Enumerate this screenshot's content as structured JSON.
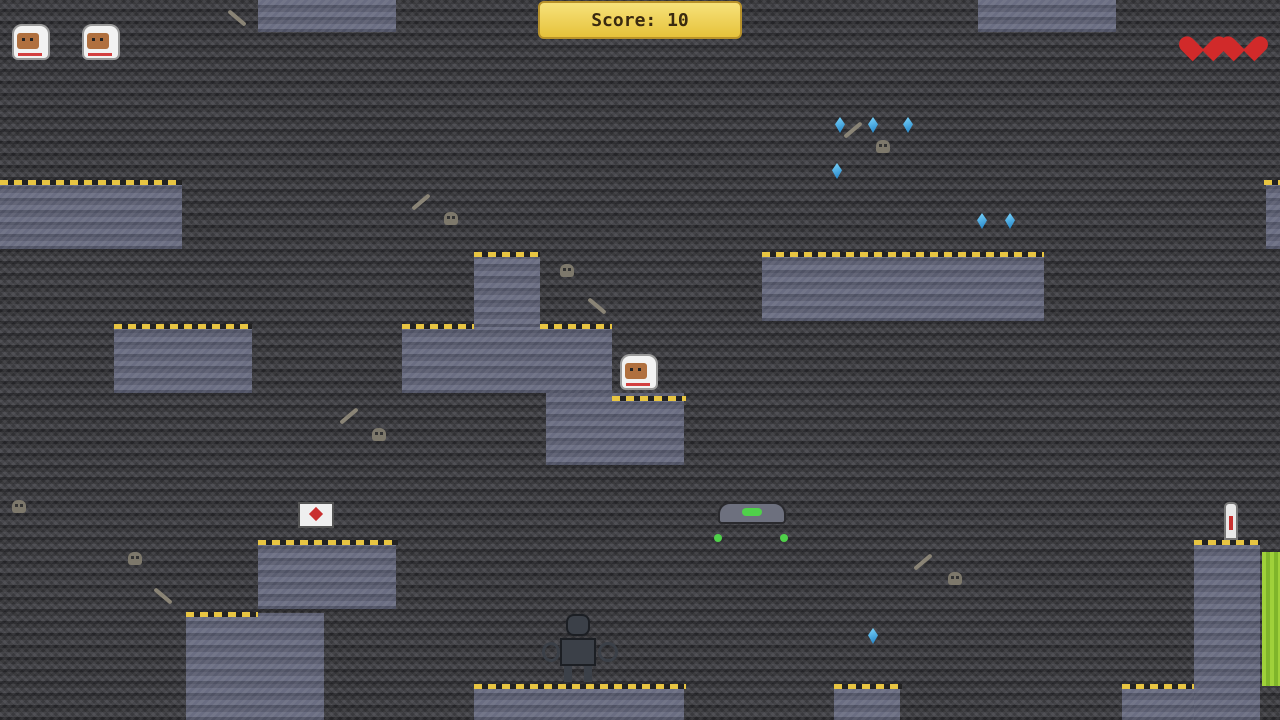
{
  "hud": {
    "score_text": "Score: 10",
    "lives_remaining": 2,
    "health_hearts": 2
  },
  "colors": {
    "background": "#3e3e42",
    "platform": "#5f6275",
    "hazard_stripe": "#e8c542",
    "heart": "#d12a2a",
    "gem": "#3fa9e6",
    "score_panel": "#f0d45a",
    "acid": "#9fd13a"
  },
  "entities": {
    "player": "astronaut",
    "enemy_walker": "skeletal-robot",
    "enemy_flyer": "green-light-drone",
    "pickup_health": "heart-crate",
    "checkpoint": "beacon",
    "collectibles": "blue-crystal"
  }
}
